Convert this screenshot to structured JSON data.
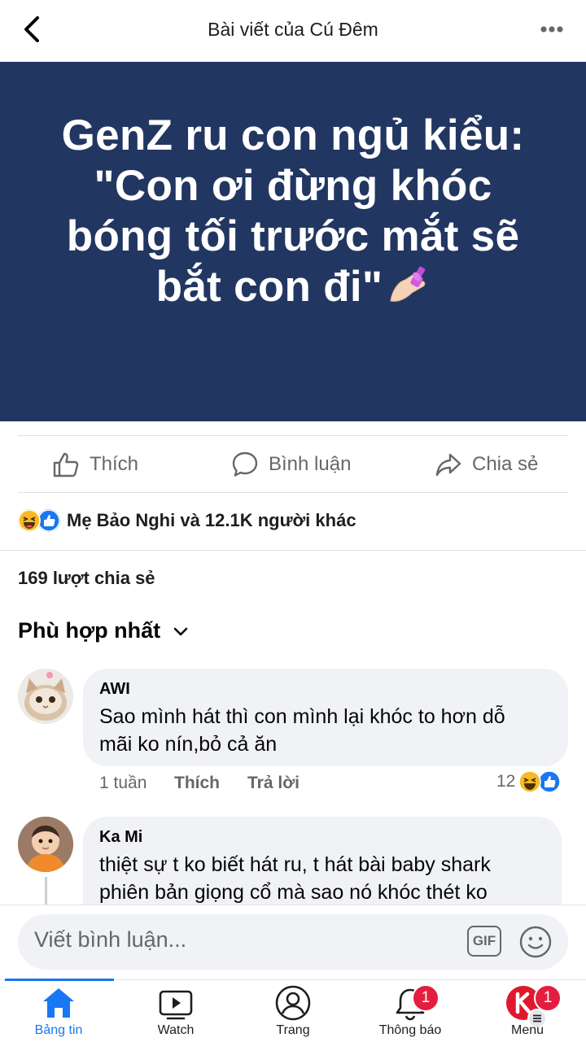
{
  "header": {
    "title": "Bài viết của Cú Đêm",
    "back_icon": "chevron-left-icon",
    "more_icon": "more-horizontal-icon"
  },
  "post": {
    "background": "#223662",
    "text_lines": [
      "GenZ ru con ngủ kiểu:",
      "\"Con ơi đừng khóc",
      "bóng tối trước mắt sẽ",
      "bắt con đi\""
    ],
    "emoji": "nail-polish-icon"
  },
  "actions": {
    "like": "Thích",
    "comment": "Bình luận",
    "share": "Chia sẻ"
  },
  "reactions": {
    "summary": "Mẹ Bảo Nghi và 12.1K người khác",
    "types": [
      "haha-icon",
      "like-icon"
    ]
  },
  "shares": "169 lượt chia sẻ",
  "sort": {
    "label": "Phù hợp nhất"
  },
  "comments": [
    {
      "name": "AWI",
      "lines": [
        "Sao mình hát thì con mình lại khóc to hơn dỗ",
        "mãi ko nín,bỏ cả ăn"
      ],
      "time": "1 tuần",
      "like": "Thích",
      "reply": "Trả lời",
      "reaction_count": "12"
    },
    {
      "name": "Ka Mi",
      "lines": [
        "thiệt sự t ko biết hát ru, t hát bài baby shark",
        "phiên bản giọng cổ mà sao nó khóc thét ko"
      ]
    }
  ],
  "composer": {
    "placeholder": "Viết bình luận...",
    "gif": "GIF"
  },
  "tabs": [
    {
      "label": "Bảng tin",
      "icon": "home-icon",
      "active": true
    },
    {
      "label": "Watch",
      "icon": "watch-icon"
    },
    {
      "label": "Trang",
      "icon": "profile-icon"
    },
    {
      "label": "Thông báo",
      "icon": "bell-icon",
      "badge": "1"
    },
    {
      "label": "Menu",
      "icon": "menu-avatar-icon",
      "badge": "1"
    }
  ],
  "colors": {
    "accent": "#1877f2",
    "badge": "#e41e3f",
    "muted": "#65676b"
  }
}
